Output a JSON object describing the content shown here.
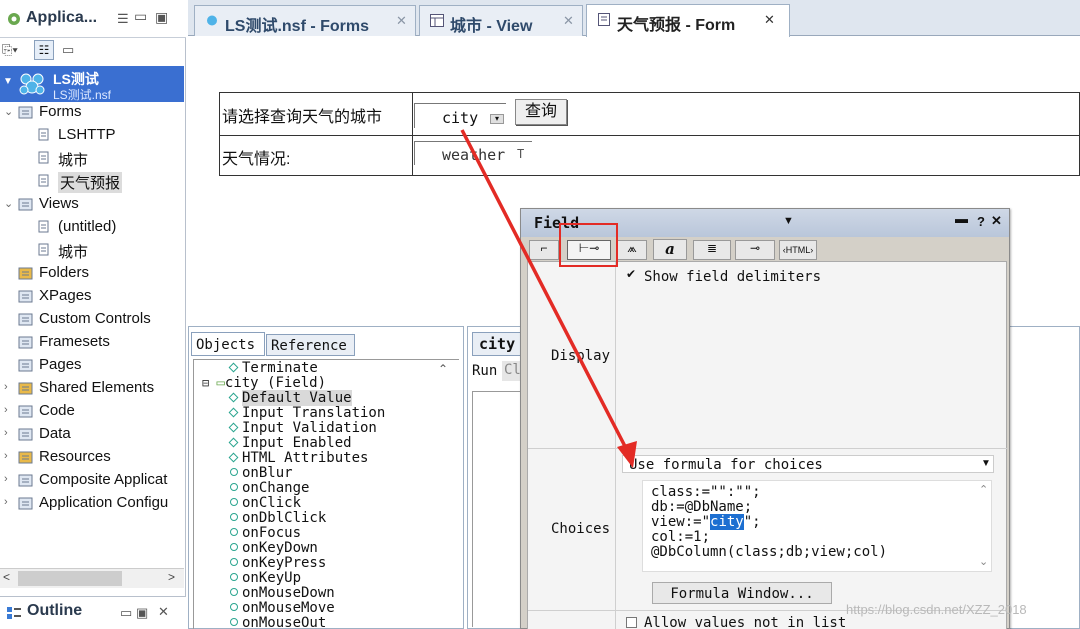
{
  "nav": {
    "title": "Applica...",
    "selected": {
      "name": "LS测试",
      "file": "LS测试.nsf"
    },
    "tree": [
      {
        "label": "Forms",
        "level": 0,
        "twisty": "open"
      },
      {
        "label": "LSHTTP",
        "level": 1
      },
      {
        "label": "城市",
        "level": 1
      },
      {
        "label": "天气预报",
        "level": 1,
        "highlight": true
      },
      {
        "label": "Views",
        "level": 0,
        "twisty": "open"
      },
      {
        "label": "(untitled)",
        "level": 1
      },
      {
        "label": "城市",
        "level": 1
      },
      {
        "label": "Folders",
        "level": 0
      },
      {
        "label": "XPages",
        "level": 0
      },
      {
        "label": "Custom Controls",
        "level": 0
      },
      {
        "label": "Framesets",
        "level": 0
      },
      {
        "label": "Pages",
        "level": 0
      },
      {
        "label": "Shared Elements",
        "level": 0,
        "twisty": "closed"
      },
      {
        "label": "Code",
        "level": 0,
        "twisty": "closed"
      },
      {
        "label": "Data",
        "level": 0,
        "twisty": "closed"
      },
      {
        "label": "Resources",
        "level": 0,
        "twisty": "closed"
      },
      {
        "label": "Composite Applicat",
        "level": 0,
        "twisty": "closed"
      },
      {
        "label": "Application Configu",
        "level": 0,
        "twisty": "closed"
      }
    ],
    "outline_title": "Outline"
  },
  "tabs": [
    {
      "label": "LS测试.nsf - Forms",
      "icon": "database-icon"
    },
    {
      "label": "城市 - View",
      "icon": "view-icon"
    },
    {
      "label": "天气预报 - Form",
      "icon": "form-icon",
      "active": true
    }
  ],
  "form": {
    "row1_label": "请选择查询天气的城市",
    "city_field": "city",
    "query_button": "查询",
    "row2_label": "天气情况:",
    "weather_field": "weather",
    "weather_type": "T"
  },
  "objects": {
    "tab_objects": "Objects",
    "tab_reference": "Reference",
    "items": [
      {
        "label": "Terminate",
        "kind": "script",
        "indent": 2
      },
      {
        "label": "city (Field)",
        "kind": "field",
        "indent": 1
      },
      {
        "label": "Default Value",
        "kind": "formula",
        "indent": 2,
        "selected": true
      },
      {
        "label": "Input Translation",
        "kind": "formula",
        "indent": 2
      },
      {
        "label": "Input Validation",
        "kind": "formula",
        "indent": 2
      },
      {
        "label": "Input Enabled",
        "kind": "formula",
        "indent": 2
      },
      {
        "label": "HTML Attributes",
        "kind": "formula",
        "indent": 2
      },
      {
        "label": "onBlur",
        "kind": "event",
        "indent": 2
      },
      {
        "label": "onChange",
        "kind": "event",
        "indent": 2
      },
      {
        "label": "onClick",
        "kind": "event",
        "indent": 2
      },
      {
        "label": "onDblClick",
        "kind": "event",
        "indent": 2
      },
      {
        "label": "onFocus",
        "kind": "event",
        "indent": 2
      },
      {
        "label": "onKeyDown",
        "kind": "event",
        "indent": 2
      },
      {
        "label": "onKeyPress",
        "kind": "event",
        "indent": 2
      },
      {
        "label": "onKeyUp",
        "kind": "event",
        "indent": 2
      },
      {
        "label": "onMouseDown",
        "kind": "event",
        "indent": 2
      },
      {
        "label": "onMouseMove",
        "kind": "event",
        "indent": 2
      },
      {
        "label": "onMouseOut",
        "kind": "event",
        "indent": 2
      }
    ]
  },
  "code": {
    "title": "city",
    "run_label": "Run",
    "client_label": "Cl"
  },
  "dialog": {
    "title": "Field",
    "display_label": "Display",
    "show_delimiters": "Show field delimiters",
    "choices_label": "Choices",
    "choices_mode": "Use formula for choices",
    "formula_lines": [
      "class:=\"\":\"\";",
      "db:=@DbName;",
      "view:=\"",
      "city",
      "\";",
      "col:=1;",
      "@DbColumn(class;db;view;col)"
    ],
    "formula_button": "Formula Window...",
    "allow_values": "Allow values not in list"
  },
  "watermark": "https://blog.csdn.net/XZZ_2018",
  "colors": {
    "selection": "#3a6fd1",
    "annotation": "#e32b25",
    "accent": "#2f4a6b"
  }
}
